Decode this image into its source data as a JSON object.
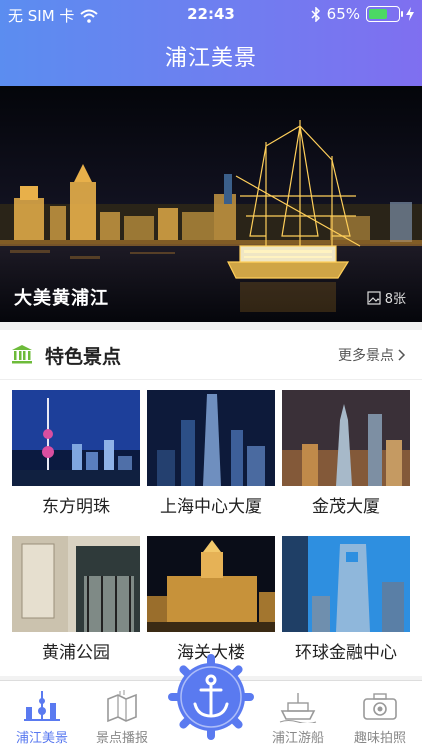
{
  "status": {
    "carrier": "无 SIM 卡",
    "time": "22:43",
    "battery": "65%",
    "battery_level": 0.65
  },
  "header": {
    "title": "浦江美景"
  },
  "hero": {
    "caption": "大美黄浦江",
    "photo_count": "8张"
  },
  "section": {
    "title": "特色景点",
    "more": "更多景点",
    "items": [
      {
        "label": "东方明珠"
      },
      {
        "label": "上海中心大厦"
      },
      {
        "label": "金茂大厦"
      },
      {
        "label": "黄浦公园"
      },
      {
        "label": "海关大楼"
      },
      {
        "label": "环球金融中心"
      }
    ]
  },
  "tabbar": {
    "tabs": [
      {
        "label": "浦江美景",
        "icon": "tower-icon"
      },
      {
        "label": "景点播报",
        "icon": "map-icon"
      },
      {
        "label": "",
        "icon": "anchor-icon"
      },
      {
        "label": "浦江游船",
        "icon": "ship-icon"
      },
      {
        "label": "趣味拍照",
        "icon": "camera-icon"
      }
    ],
    "active_color": "#5a7af0",
    "inactive_color": "#888888"
  }
}
